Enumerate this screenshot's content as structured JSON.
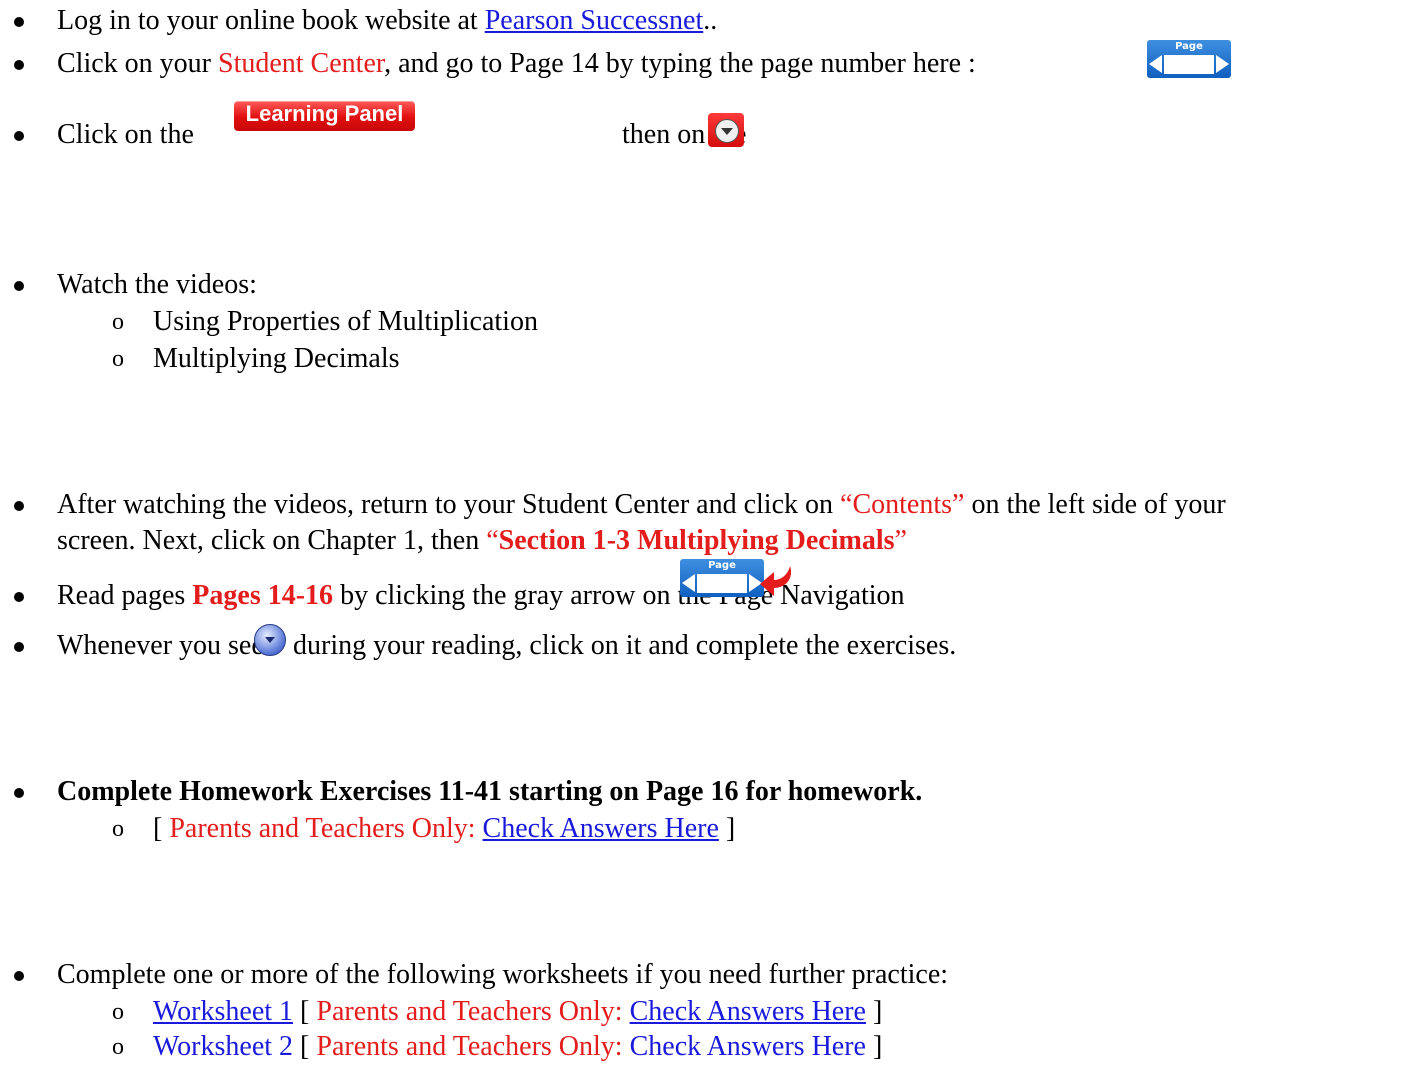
{
  "steps": {
    "login": {
      "prefix": "Log in to your online book website at ",
      "link": "Pearson Successnet",
      "suffix": ".."
    },
    "student_center": {
      "prefix": "Click on your ",
      "highlight": "Student Center",
      "suffix": ", and go to Page 14 by typing the page number here :",
      "nav_label": "Page"
    },
    "learning_panel": {
      "prefix": "Click on the",
      "button_label": "Learning Panel",
      "middle": "then on the"
    },
    "videos": {
      "intro": "Watch the videos:",
      "items": [
        "Using Properties of Multiplication",
        "Multiplying Decimals"
      ]
    },
    "after_videos": {
      "part1": "After watching the videos, return to your Student Center and click on ",
      "contents": "“Contents”",
      "part2": " on the left side of your",
      "line2_part1": "screen.  Next, click on Chapter 1, then ",
      "section_open": "“",
      "section": "Section 1-3 Multiplying Decimals",
      "section_close": "”"
    },
    "read_pages": {
      "prefix": "Read pages ",
      "pages": "Pages 14-16",
      "suffix": " by clicking the gray arrow on the Page Navigation",
      "nav_label": "Page"
    },
    "exercises": {
      "prefix": "Whenever you see",
      "suffix": "during your reading, click on it and complete the exercises."
    },
    "homework": {
      "title": "Complete Homework Exercises 11-41  starting on Page 16 for homework.",
      "bracket_open": "[ ",
      "parents_label": "Parents and Teachers Only: ",
      "answers_link": "Check Answers Here",
      "bracket_close": " ]"
    },
    "worksheets": {
      "intro": "Complete one or more of the following worksheets if you need further practice:",
      "items": [
        {
          "link": "Worksheet 1",
          "parents_label": "Parents and Teachers Only: ",
          "answers_link": "Check Answers Here"
        },
        {
          "link": "Worksheet 2",
          "parents_label": "Parents and Teachers Only: ",
          "answers_link": "Check Answers Here"
        }
      ],
      "bracket_open": "[ ",
      "bracket_close": " ]"
    }
  },
  "colors": {
    "red": "#e41c1c",
    "link": "#1a1adc",
    "button_red": "#e00f0f",
    "nav_blue": "#1f6fcf"
  }
}
